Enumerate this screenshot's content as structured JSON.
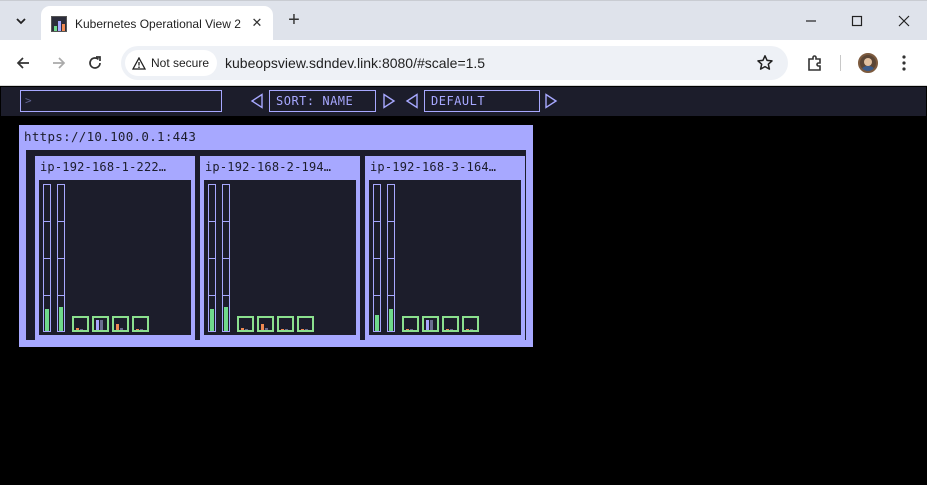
{
  "browser": {
    "tab_title": "Kubernetes Operational View 2",
    "security_label": "Not secure",
    "url": "kubeopsview.sdndev.link:8080/#scale=1.5"
  },
  "kube_ops_view": {
    "filter_placeholder": ">",
    "sort_label": "SORT: NAME",
    "theme_label": "DEFAULT",
    "colors": {
      "foreground": "#a7a8ff",
      "background": "#1c1d2b",
      "pod_ok": "#8be08e"
    },
    "cluster": {
      "title": "https://10.100.0.1:443",
      "nodes": [
        {
          "name": "ip-192-168-1-222…",
          "pod_count": 4
        },
        {
          "name": "ip-192-168-2-194…",
          "pod_count": 4
        },
        {
          "name": "ip-192-168-3-164…",
          "pod_count": 4
        }
      ]
    }
  }
}
